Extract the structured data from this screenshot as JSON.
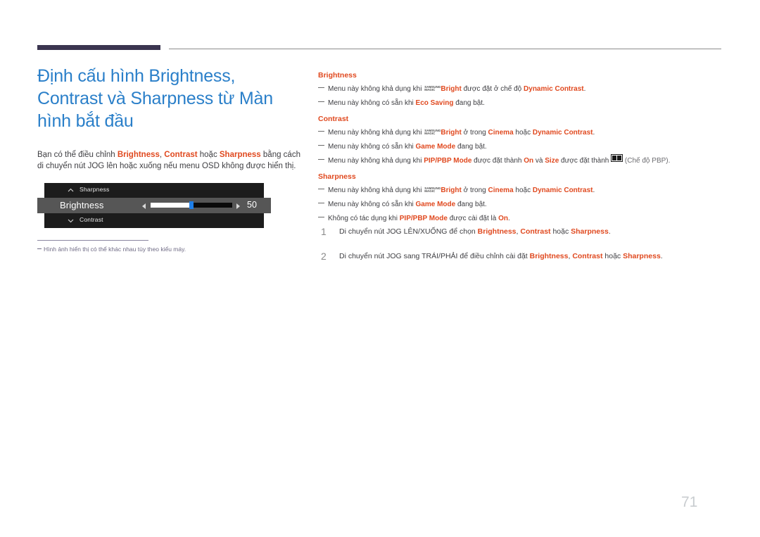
{
  "header": {
    "bar_color": "#3b3550",
    "rule_color": "#8c8c8c"
  },
  "left": {
    "title": "Định cấu hình Brightness, Contrast và Sharpness từ Màn hình bắt đầu",
    "intro": {
      "t1": "Bạn có thể điều chỉnh ",
      "hl1": "Brightness",
      "t2": ", ",
      "hl2": "Contrast",
      "t3": " hoặc ",
      "hl3": "Sharpness",
      "t4": " bằng cách di chuyển nút JOG lên hoặc xuống nếu menu OSD không được hiển thị."
    },
    "osd": {
      "row_top_label": "Sharpness",
      "row_middle_label": "Brightness",
      "row_bottom_label": "Contrast",
      "value": "50",
      "slider_percent": 50,
      "thumb_color": "#1f7fe8",
      "row_bg": "#1c1c1c",
      "row_active_bg": "#565656"
    },
    "footnote": "Hình ảnh hiển thị có thể khác nhau tùy theo kiểu máy."
  },
  "right": {
    "sections": [
      {
        "heading": "Brightness",
        "notes": [
          {
            "parts": [
              {
                "type": "text",
                "text": "Menu này không khả dụng khi "
              },
              {
                "type": "magic"
              },
              {
                "type": "hl",
                "text": "Bright"
              },
              {
                "type": "text",
                "text": " được đặt ở chế độ "
              },
              {
                "type": "hl",
                "text": "Dynamic Contrast"
              },
              {
                "type": "text",
                "text": "."
              }
            ]
          },
          {
            "parts": [
              {
                "type": "text",
                "text": "Menu này không có sẵn khi "
              },
              {
                "type": "hl",
                "text": "Eco Saving"
              },
              {
                "type": "text",
                "text": " đang bật."
              }
            ]
          }
        ]
      },
      {
        "heading": "Contrast",
        "notes": [
          {
            "parts": [
              {
                "type": "text",
                "text": "Menu này không khả dụng khi "
              },
              {
                "type": "magic"
              },
              {
                "type": "hl",
                "text": "Bright"
              },
              {
                "type": "text",
                "text": " ở trong "
              },
              {
                "type": "hl",
                "text": "Cinema"
              },
              {
                "type": "text",
                "text": " hoặc "
              },
              {
                "type": "hl",
                "text": "Dynamic Contrast"
              },
              {
                "type": "text",
                "text": "."
              }
            ]
          },
          {
            "parts": [
              {
                "type": "text",
                "text": "Menu này không có sẵn khi "
              },
              {
                "type": "hl",
                "text": "Game Mode"
              },
              {
                "type": "text",
                "text": " đang bật."
              }
            ]
          },
          {
            "parts": [
              {
                "type": "text",
                "text": "Menu này không khả dụng khi "
              },
              {
                "type": "hl",
                "text": "PIP/PBP Mode"
              },
              {
                "type": "text",
                "text": " được đặt thành "
              },
              {
                "type": "hl",
                "text": "On"
              },
              {
                "type": "text",
                "text": " và "
              },
              {
                "type": "hl",
                "text": "Size"
              },
              {
                "type": "text",
                "text": " được đặt thành "
              },
              {
                "type": "pbpicon"
              },
              {
                "type": "muted",
                "text": " (Chế độ PBP)."
              }
            ]
          }
        ]
      },
      {
        "heading": "Sharpness",
        "notes": [
          {
            "parts": [
              {
                "type": "text",
                "text": "Menu này không khả dụng khi "
              },
              {
                "type": "magic"
              },
              {
                "type": "hl",
                "text": "Bright"
              },
              {
                "type": "text",
                "text": " ở trong "
              },
              {
                "type": "hl",
                "text": "Cinema"
              },
              {
                "type": "text",
                "text": " hoặc "
              },
              {
                "type": "hl",
                "text": "Dynamic Contrast"
              },
              {
                "type": "text",
                "text": "."
              }
            ]
          },
          {
            "parts": [
              {
                "type": "text",
                "text": "Menu này không có sẵn khi "
              },
              {
                "type": "hl",
                "text": "Game Mode"
              },
              {
                "type": "text",
                "text": " đang bật."
              }
            ]
          },
          {
            "parts": [
              {
                "type": "text",
                "text": "Không có tác dụng khi "
              },
              {
                "type": "hl",
                "text": "PIP/PBP Mode"
              },
              {
                "type": "text",
                "text": " được cài đặt là "
              },
              {
                "type": "hl",
                "text": "On"
              },
              {
                "type": "text",
                "text": "."
              }
            ]
          }
        ]
      }
    ],
    "magic_logo": {
      "line1": "SAMSUNG",
      "line2": "MAGIC"
    },
    "steps": [
      {
        "number": "1",
        "parts": [
          {
            "type": "text",
            "text": "Di chuyển nút JOG LÊN/XUỐNG để chọn "
          },
          {
            "type": "hl",
            "text": "Brightness"
          },
          {
            "type": "text",
            "text": ", "
          },
          {
            "type": "hl",
            "text": "Contrast"
          },
          {
            "type": "text",
            "text": " hoặc "
          },
          {
            "type": "hl",
            "text": "Sharpness"
          },
          {
            "type": "text",
            "text": "."
          }
        ]
      },
      {
        "number": "2",
        "parts": [
          {
            "type": "text",
            "text": "Di chuyển nút JOG sang TRÁI/PHẢI để điều chỉnh cài đặt "
          },
          {
            "type": "hl",
            "text": "Brightness"
          },
          {
            "type": "text",
            "text": ", "
          },
          {
            "type": "hl",
            "text": "Contrast"
          },
          {
            "type": "text",
            "text": " hoặc "
          },
          {
            "type": "hl",
            "text": "Sharpness"
          },
          {
            "type": "text",
            "text": "."
          }
        ]
      }
    ]
  },
  "page_number": "71",
  "colors": {
    "accent_orange": "#e0491f",
    "title_blue": "#2a7fc9",
    "body_gray": "#3e3e42",
    "footnote_purple": "#6f6b85"
  }
}
